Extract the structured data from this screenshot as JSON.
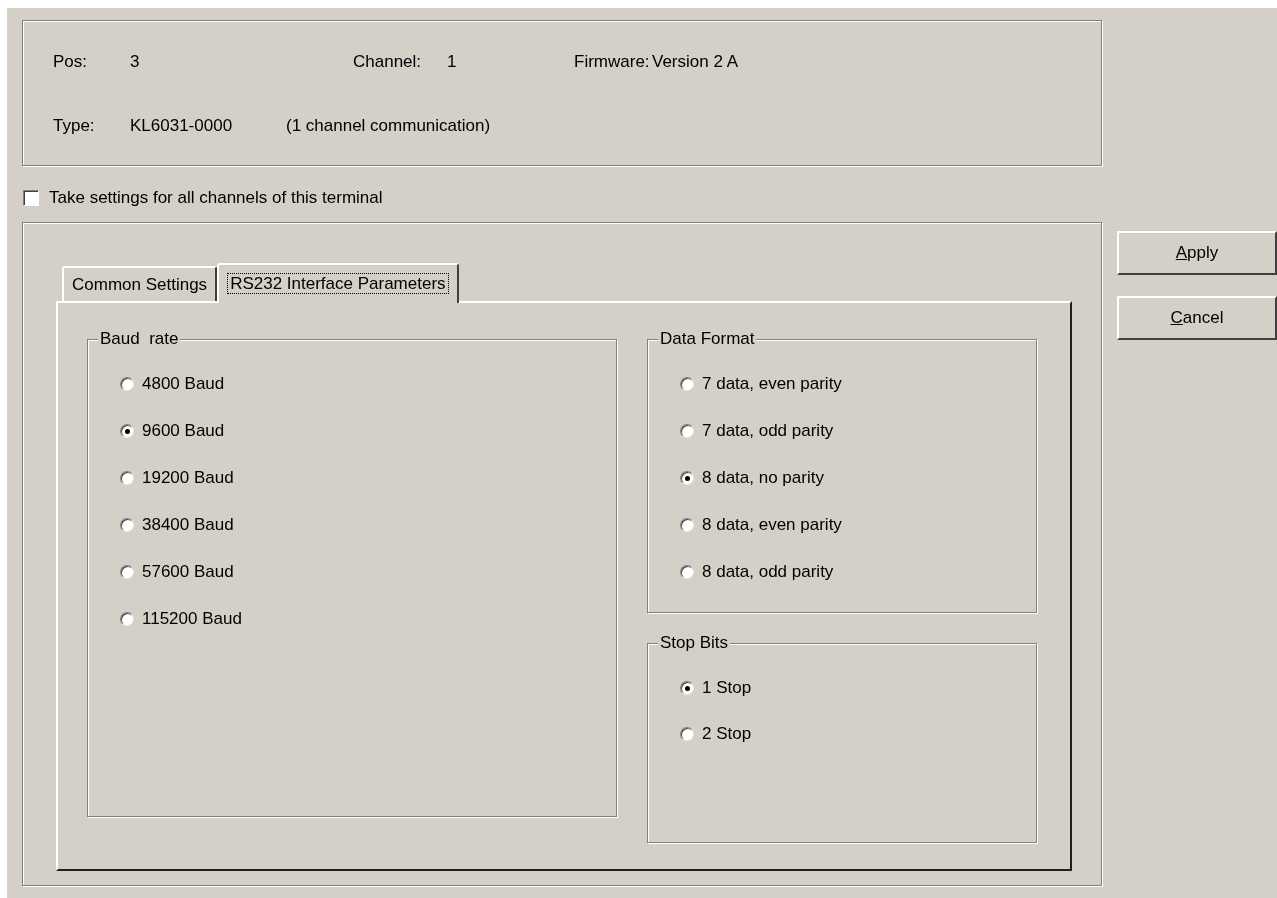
{
  "info": {
    "fields": [
      {
        "label": "Pos:",
        "value": "3"
      },
      {
        "label": "Channel:",
        "value": "1"
      },
      {
        "label": "Firmware:",
        "value": "Version 2 A"
      }
    ],
    "type": {
      "label": "Type:",
      "value": "KL6031-0000",
      "description": "(1 channel communication)"
    }
  },
  "all_channels": {
    "label": "Take settings for all channels of this terminal",
    "checked": false
  },
  "tabs": [
    {
      "label": "Common Settings",
      "selected": false
    },
    {
      "label": "RS232 Interface Parameters",
      "selected": true
    }
  ],
  "baud_rate": {
    "title": "Baud  rate",
    "options": [
      {
        "label": "4800 Baud",
        "selected": false
      },
      {
        "label": "9600 Baud",
        "selected": true
      },
      {
        "label": "19200 Baud",
        "selected": false
      },
      {
        "label": "38400 Baud",
        "selected": false
      },
      {
        "label": "57600 Baud",
        "selected": false
      },
      {
        "label": "115200 Baud",
        "selected": false
      }
    ]
  },
  "data_format": {
    "title": "Data Format",
    "options": [
      {
        "label": "7 data, even parity",
        "selected": false
      },
      {
        "label": "7 data, odd parity",
        "selected": false
      },
      {
        "label": "8 data, no parity",
        "selected": true
      },
      {
        "label": "8 data, even parity",
        "selected": false
      },
      {
        "label": "8 data, odd parity",
        "selected": false
      }
    ]
  },
  "stop_bits": {
    "title": "Stop Bits",
    "options": [
      {
        "label": "1 Stop",
        "selected": true
      },
      {
        "label": "2 Stop",
        "selected": false
      }
    ]
  },
  "buttons": [
    {
      "label": "Apply"
    },
    {
      "label": "Cancel"
    }
  ]
}
